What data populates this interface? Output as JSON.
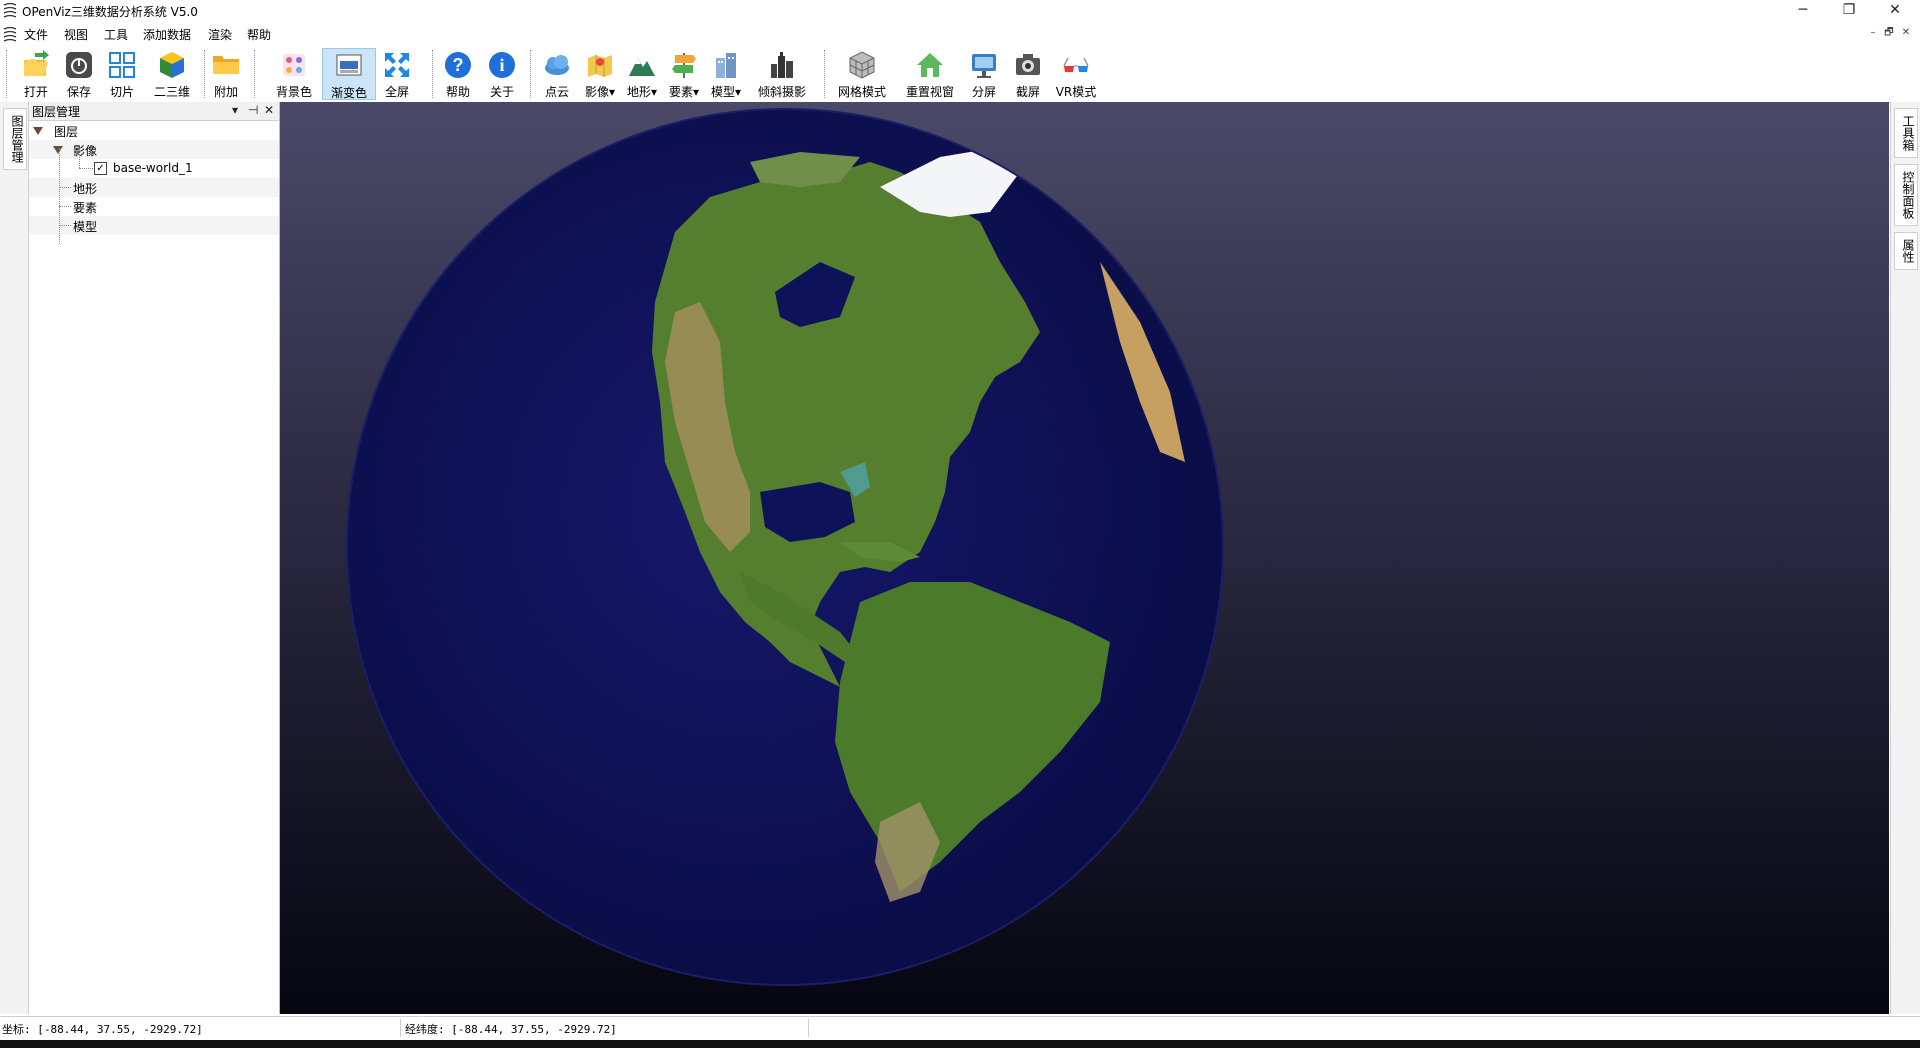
{
  "window": {
    "title": "OPenViz三维数据分析系统 V5.0",
    "controls": {
      "minimize": "─",
      "restore": "❐",
      "close": "✕"
    }
  },
  "menu": [
    "文件",
    "视图",
    "工具",
    "添加数据",
    "渲染",
    "帮助"
  ],
  "mdi_controls": [
    "–",
    "🗗",
    "✕"
  ],
  "toolbar": {
    "buttons": [
      {
        "label": "打开",
        "icon": "open-folder-icon"
      },
      {
        "label": "保存",
        "icon": "save-icon"
      },
      {
        "label": "切片",
        "icon": "tile-grid-icon"
      },
      {
        "label": "二三维",
        "icon": "cube-icon"
      },
      {
        "label": "附加",
        "icon": "folder-icon"
      },
      {
        "label": "背景色",
        "icon": "palette-icon"
      },
      {
        "label": "渐变色",
        "icon": "gradient-icon",
        "active": true
      },
      {
        "label": "全屏",
        "icon": "fullscreen-icon"
      },
      {
        "label": "帮助",
        "icon": "help-icon"
      },
      {
        "label": "关于",
        "icon": "info-icon"
      },
      {
        "label": "点云",
        "icon": "point-cloud-icon"
      },
      {
        "label": "影像▾",
        "icon": "imagery-icon"
      },
      {
        "label": "地形▾",
        "icon": "terrain-icon"
      },
      {
        "label": "要素▾",
        "icon": "feature-icon"
      },
      {
        "label": "模型▾",
        "icon": "model-icon"
      },
      {
        "label": "倾斜摄影",
        "icon": "oblique-photo-icon"
      },
      {
        "label": "网格模式",
        "icon": "wireframe-icon"
      },
      {
        "label": "重置视窗",
        "icon": "home-icon"
      },
      {
        "label": "分屏",
        "icon": "split-screen-icon"
      },
      {
        "label": "截屏",
        "icon": "camera-icon"
      },
      {
        "label": "VR模式",
        "icon": "vr-glasses-icon"
      }
    ]
  },
  "left_dock": {
    "tab": "图层管理"
  },
  "layer_panel": {
    "title": "图层管理",
    "header_buttons": [
      "▾",
      "⊣",
      "✕"
    ],
    "tree": {
      "root": "图层",
      "imagery": "影像",
      "imagery_child": "base-world_1",
      "imagery_child_checked": true,
      "terrain": "地形",
      "features": "要素",
      "models": "模型"
    }
  },
  "right_dock": {
    "tabs": [
      "工具箱",
      "控制面板",
      "属性"
    ]
  },
  "viewport": {
    "background_top": "#4a4968",
    "background_bottom": "#060611",
    "ocean_color": "#0d1150",
    "land_color": "#4f7a2e",
    "ice_color": "#f2f4f6"
  },
  "status": {
    "coord": "坐标: [-88.44, 37.55, -2929.72]",
    "lonlat": "经纬度: [-88.44, 37.55, -2929.72]"
  }
}
